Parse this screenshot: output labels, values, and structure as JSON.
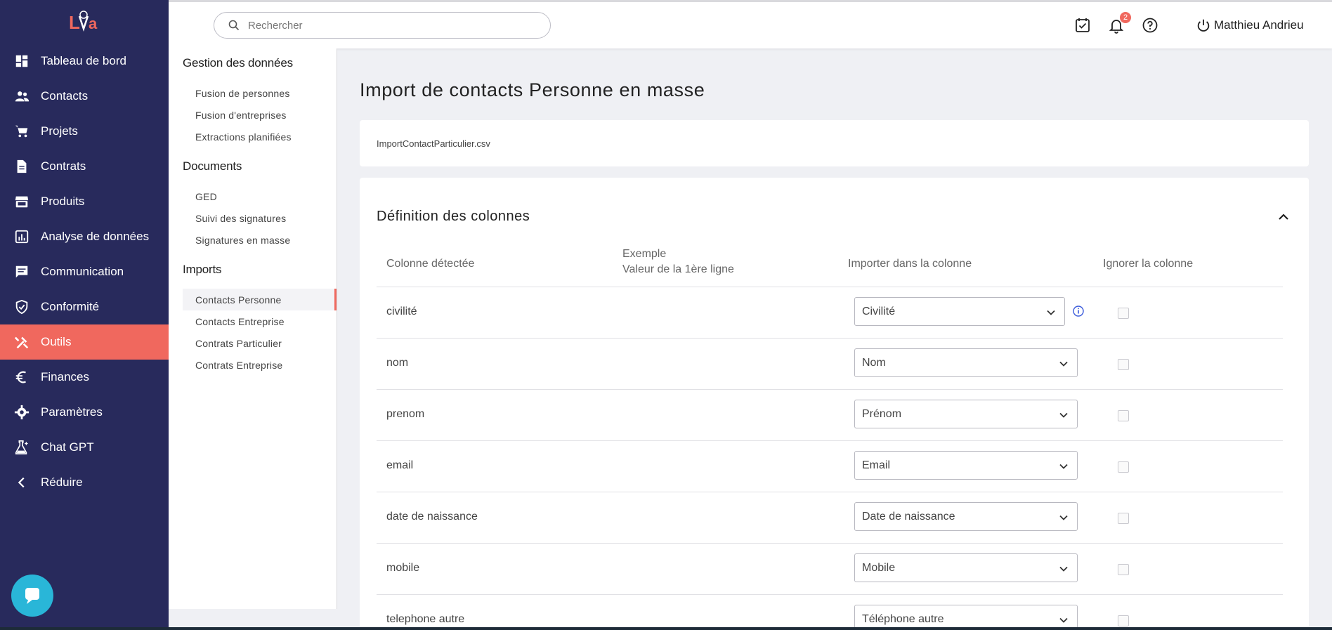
{
  "app": {
    "logo_text": "Lya"
  },
  "sidebar": {
    "items": [
      {
        "label": "Tableau de bord",
        "icon": "dashboard-icon"
      },
      {
        "label": "Contacts",
        "icon": "people-icon"
      },
      {
        "label": "Projets",
        "icon": "cart-icon"
      },
      {
        "label": "Contrats",
        "icon": "document-icon"
      },
      {
        "label": "Produits",
        "icon": "store-icon"
      },
      {
        "label": "Analyse de données",
        "icon": "chart-icon"
      },
      {
        "label": "Communication",
        "icon": "message-icon"
      },
      {
        "label": "Conformité",
        "icon": "shield-icon"
      },
      {
        "label": "Outils",
        "icon": "tools-icon",
        "active": true
      },
      {
        "label": "Finances",
        "icon": "euro-icon"
      },
      {
        "label": "Paramètres",
        "icon": "gear-icon"
      },
      {
        "label": "Chat GPT",
        "icon": "flask-icon"
      },
      {
        "label": "Réduire",
        "icon": "chevron-left-icon"
      }
    ]
  },
  "topbar": {
    "search_placeholder": "Rechercher",
    "notification_count": "2",
    "user_name": "Matthieu Andrieu"
  },
  "submenu": {
    "sections": [
      {
        "heading": "Gestion des données",
        "items": [
          "Fusion de personnes",
          "Fusion d'entreprises",
          "Extractions planifiées"
        ]
      },
      {
        "heading": "Documents",
        "items": [
          "GED",
          "Suivi des signatures",
          "Signatures en masse"
        ]
      },
      {
        "heading": "Imports",
        "items": [
          "Contacts Personne",
          "Contacts Entreprise",
          "Contrats Particulier",
          "Contrats Entreprise"
        ]
      }
    ],
    "active_item": "Contacts Personne"
  },
  "main": {
    "title": "Import de contacts Personne en masse",
    "file_name": "ImportContactParticulier.csv",
    "definition": {
      "title": "Définition des colonnes",
      "headers": {
        "detected": "Colonne détectée",
        "example_line1": "Exemple",
        "example_line2": "Valeur de la 1ère ligne",
        "import_into": "Importer dans la colonne",
        "ignore": "Ignorer la colonne"
      },
      "rows": [
        {
          "detected": "civilité",
          "target": "Civilité",
          "has_info": true
        },
        {
          "detected": "nom",
          "target": "Nom"
        },
        {
          "detected": "prenom",
          "target": "Prénom"
        },
        {
          "detected": "email",
          "target": "Email"
        },
        {
          "detected": "date de naissance",
          "target": "Date de naissance"
        },
        {
          "detected": "mobile",
          "target": "Mobile"
        },
        {
          "detected": "telephone autre",
          "target": "Téléphone autre"
        }
      ]
    }
  },
  "colors": {
    "sidebar_bg": "#282a5c",
    "accent": "#f0685e",
    "chat_bubble": "#29b6d8"
  }
}
